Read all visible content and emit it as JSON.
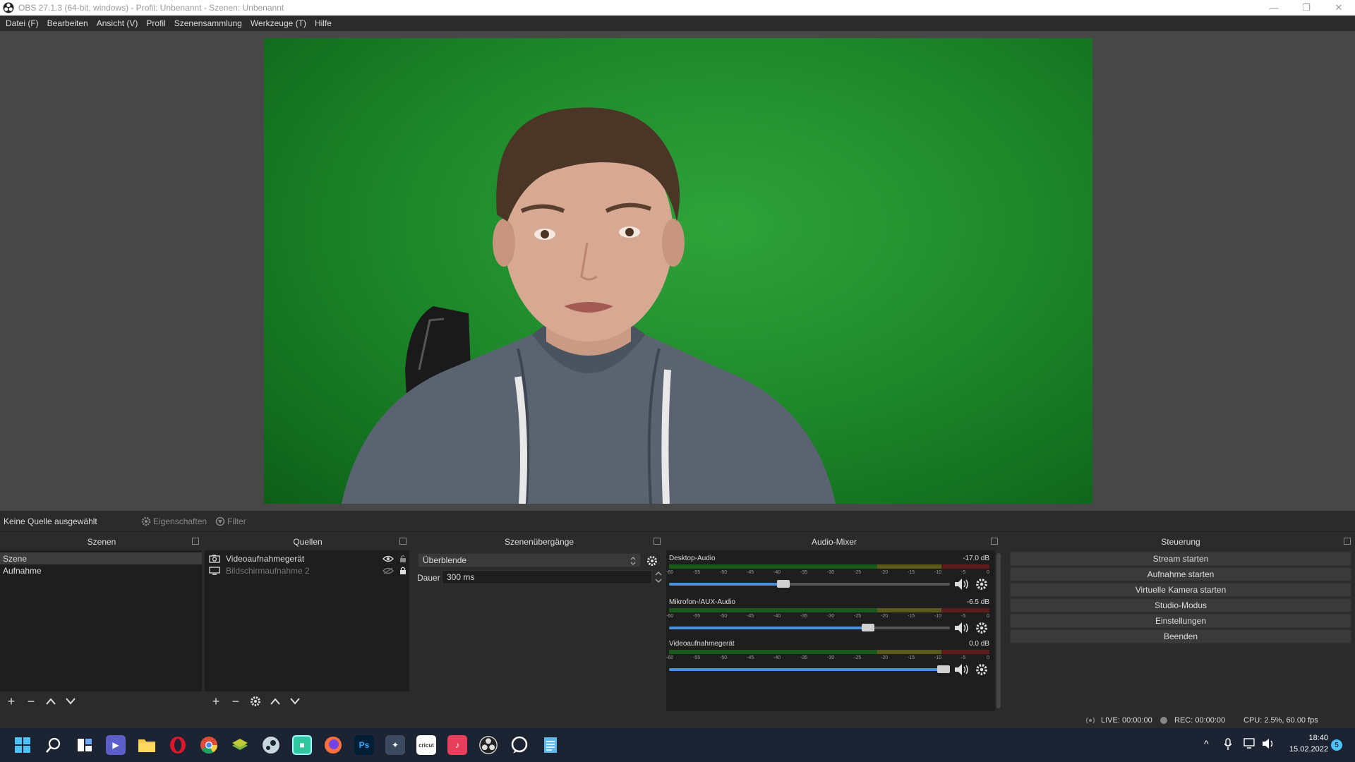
{
  "window": {
    "title": "OBS 27.1.3 (64-bit, windows) - Profil: Unbenannt - Szenen: Unbenannt",
    "minimize": "—",
    "restore": "❐",
    "close": "✕"
  },
  "menu": [
    "Datei (F)",
    "Bearbeiten",
    "Ansicht (V)",
    "Profil",
    "Szenensammlung",
    "Werkzeuge (T)",
    "Hilfe"
  ],
  "source_bar": {
    "no_source": "Keine Quelle ausgewählt",
    "properties": "Eigenschaften",
    "filter": "Filter"
  },
  "scenes": {
    "title": "Szenen",
    "items": [
      "Szene",
      "Aufnahme"
    ],
    "selected": 0
  },
  "sources": {
    "title": "Quellen",
    "items": [
      {
        "name": "Videoaufnahmegerät",
        "visible": true,
        "locked": false
      },
      {
        "name": "Bildschirmaufnahme 2",
        "visible": false,
        "locked": true
      }
    ]
  },
  "transitions": {
    "title": "Szenenübergänge",
    "selected": "Überblende",
    "duration_label": "Dauer",
    "duration_value": "300 ms"
  },
  "mixer": {
    "title": "Audio-Mixer",
    "scale": [
      "-60",
      "-55",
      "-50",
      "-45",
      "-40",
      "-35",
      "-30",
      "-25",
      "-20",
      "-15",
      "-10",
      "-5",
      "0"
    ],
    "channels": [
      {
        "name": "Desktop-Audio",
        "db": "-17.0 dB",
        "volume": 0.43
      },
      {
        "name": "Mikrofon-/AUX-Audio",
        "db": "-6.5 dB",
        "volume": 0.73
      },
      {
        "name": "Videoaufnahmegerät",
        "db": "0.0 dB",
        "volume": 1.0
      }
    ]
  },
  "controls": {
    "title": "Steuerung",
    "buttons": [
      "Stream starten",
      "Aufnahme starten",
      "Virtuelle Kamera starten",
      "Studio-Modus",
      "Einstellungen",
      "Beenden"
    ]
  },
  "status": {
    "live": "LIVE: 00:00:00",
    "rec": "REC: 00:00:00",
    "cpu": "CPU: 2.5%, 60.00 fps"
  },
  "taskbar": {
    "time": "18:40",
    "date": "15.02.2022",
    "notifications": "5",
    "ps_label": "Ps",
    "cricut_label": "cricut",
    "chevron": "^"
  },
  "colors": {
    "accent": "#4a8fd8",
    "panel": "#2b2b2b",
    "list_bg": "#1e1e1e",
    "green_screen": "#1f8a2b"
  }
}
